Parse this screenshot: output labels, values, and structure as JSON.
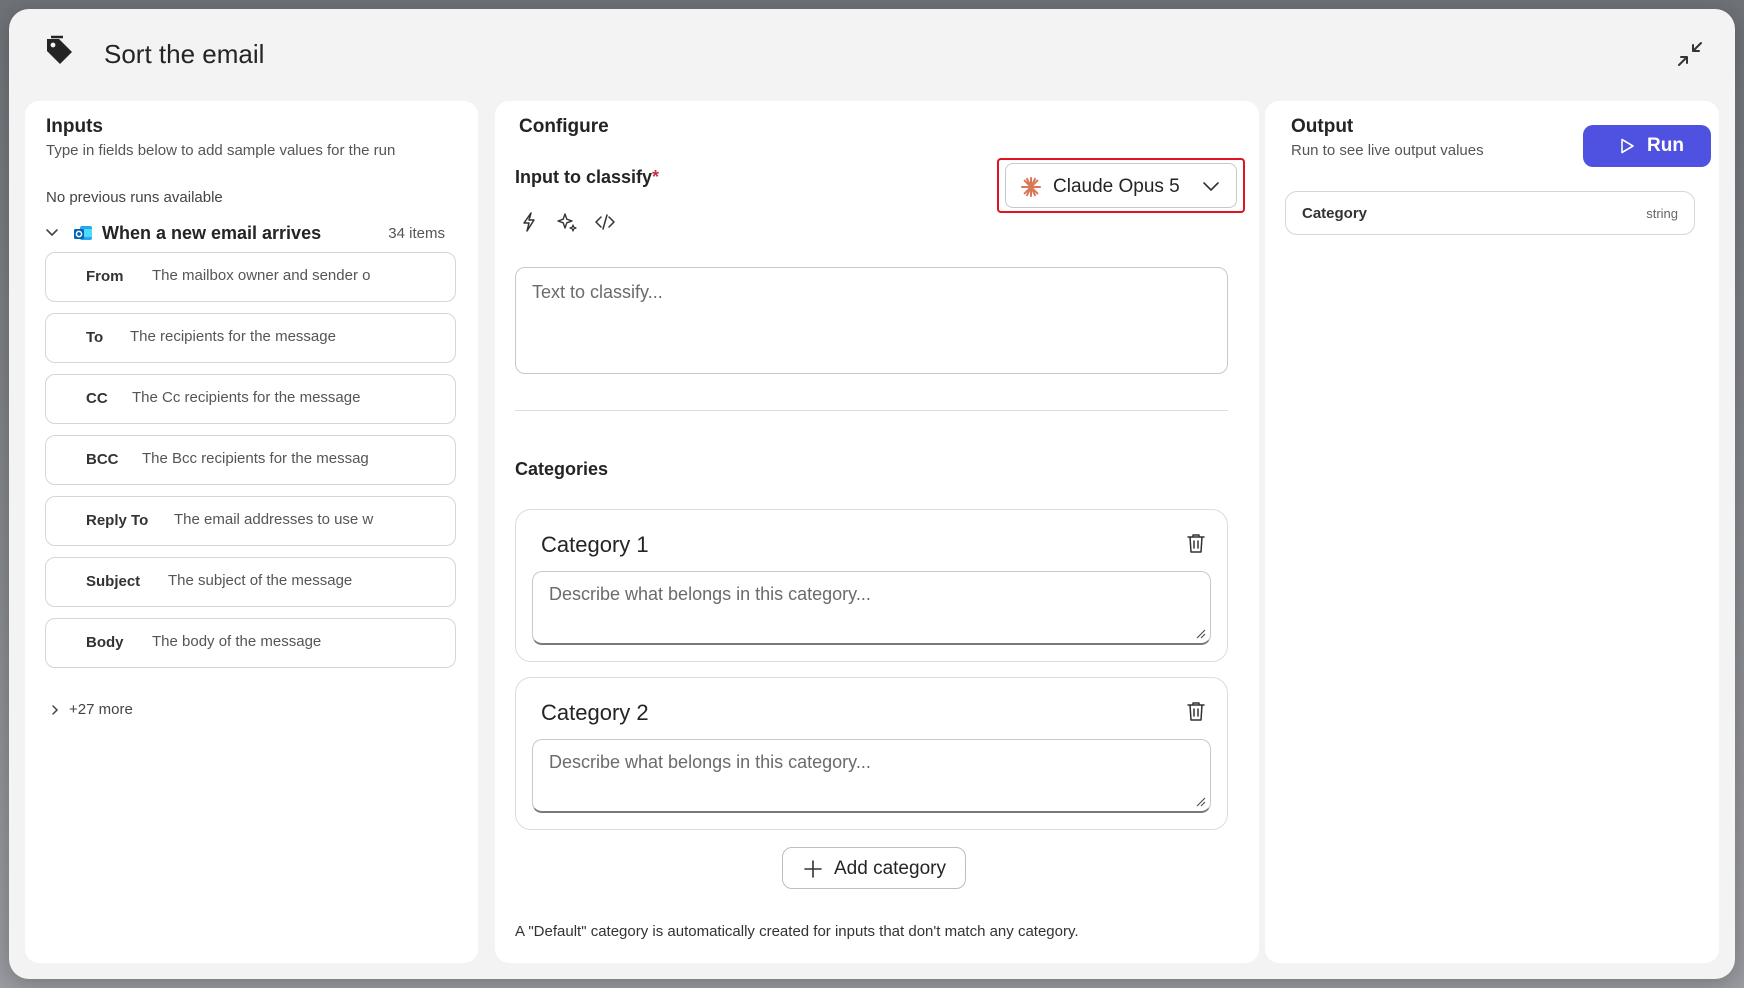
{
  "header": {
    "title": "Sort the email",
    "tag_icon": "tag-icon",
    "collapse_icon": "collapse-icon"
  },
  "inputs": {
    "title": "Inputs",
    "subtitle": "Type in fields below to add sample values for the run",
    "no_runs": "No previous runs available",
    "trigger": {
      "label": "When a new email arrives",
      "count": "34 items",
      "icon": "outlook-icon"
    },
    "fields": [
      {
        "label": "From",
        "hint": "The mailbox owner and sender o"
      },
      {
        "label": "To",
        "hint": "The recipients for the message"
      },
      {
        "label": "CC",
        "hint": "The Cc recipients for the message"
      },
      {
        "label": "BCC",
        "hint": "The Bcc recipients for the messag"
      },
      {
        "label": "Reply To",
        "hint": "The email addresses to use w"
      },
      {
        "label": "Subject",
        "hint": "The subject of the message"
      },
      {
        "label": "Body",
        "hint": "The body of the message"
      }
    ],
    "more": "+27 more"
  },
  "configure": {
    "title": "Configure",
    "input_label": "Input to classify",
    "required_mark": "*",
    "model": "Claude Opus 5",
    "tool_icons": [
      "lightning-icon",
      "sparkle-icon",
      "code-icon"
    ],
    "classify_placeholder": "Text to classify...",
    "categories_title": "Categories",
    "categories": [
      {
        "title": "Category 1",
        "placeholder": "Describe what belongs in this category..."
      },
      {
        "title": "Category 2",
        "placeholder": "Describe what belongs in this category..."
      }
    ],
    "add_category": "Add category",
    "footnote": "A \"Default\" category is automatically created for inputs that don't match any category."
  },
  "output": {
    "title": "Output",
    "subtitle": "Run to see live output values",
    "run_label": "Run",
    "field": {
      "name": "Category",
      "type": "string"
    }
  },
  "colors": {
    "accent": "#4f52e0",
    "highlight": "#e0131f",
    "model_spark": "#d97757",
    "required": "#c4314b"
  }
}
